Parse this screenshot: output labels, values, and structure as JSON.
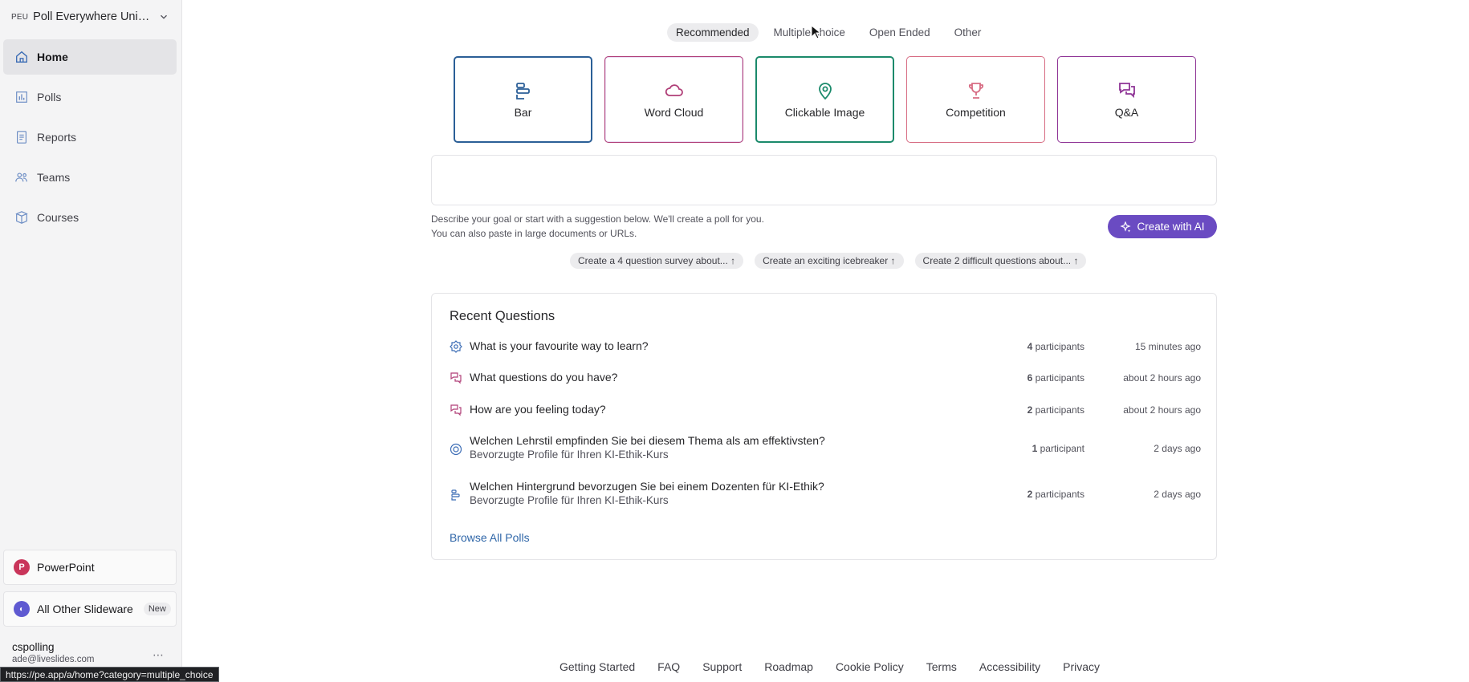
{
  "sidebar": {
    "org_abbr": "PEU",
    "org_name": "Poll Everywhere Unive...",
    "items": [
      {
        "label": "Home",
        "icon": "home-icon"
      },
      {
        "label": "Polls",
        "icon": "bar-chart-icon"
      },
      {
        "label": "Reports",
        "icon": "report-icon"
      },
      {
        "label": "Teams",
        "icon": "teams-icon"
      },
      {
        "label": "Courses",
        "icon": "courses-icon"
      }
    ],
    "powerpoint_label": "PowerPoint",
    "powerpoint_icon_letter": "P",
    "slideware_label": "All Other Slideware",
    "slideware_badge": "New",
    "user_name": "cspolling",
    "user_email": "ade@liveslides.com",
    "more": "⋯",
    "status_url": "https://pe.app/a/home?category=multiple_choice"
  },
  "tabs": [
    "Recommended",
    "Multiple choice",
    "Open Ended",
    "Other"
  ],
  "active_tab": "Recommended",
  "cards": [
    {
      "label": "Bar",
      "icon": "bar-poll-icon",
      "color": "#2b5f97"
    },
    {
      "label": "Word Cloud",
      "icon": "cloud-icon",
      "color": "#b03f78"
    },
    {
      "label": "Clickable Image",
      "icon": "map-pin-icon",
      "color": "#1b8a6b"
    },
    {
      "label": "Competition",
      "icon": "trophy-icon",
      "color": "#d76c83"
    },
    {
      "label": "Q&A",
      "icon": "chat-bubbles-icon",
      "color": "#8f3596"
    }
  ],
  "prompt": {
    "placeholder": "",
    "hint_line1": "Describe your goal or start with a suggestion below. We'll create a poll for you.",
    "hint_line2": "You can also paste in large documents or URLs.",
    "ai_button": "Create with AI",
    "suggestions": [
      "Create a 4 question survey about... ↑",
      "Create an exciting icebreaker ↑",
      "Create 2 difficult questions about... ↑"
    ]
  },
  "recent": {
    "title": "Recent Questions",
    "rows": [
      {
        "title": "What is your favourite way to learn?",
        "subtitle": "",
        "count": "4",
        "participants": "participants",
        "time": "15 minutes ago",
        "icon": "multiple-choice-icon"
      },
      {
        "title": "What questions do you have?",
        "subtitle": "",
        "count": "6",
        "participants": "participants",
        "time": "about 2 hours ago",
        "icon": "qa-icon"
      },
      {
        "title": "How are you feeling today?",
        "subtitle": "",
        "count": "2",
        "participants": "participants",
        "time": "about 2 hours ago",
        "icon": "qa-icon"
      },
      {
        "title": "Welchen Lehrstil empfinden Sie bei diesem Thema als am effektivsten?",
        "subtitle": "Bevorzugte Profile für Ihren KI-Ethik-Kurs",
        "count": "1",
        "participants": "participant",
        "time": "2 days ago",
        "icon": "target-icon"
      },
      {
        "title": "Welchen Hintergrund bevorzugen Sie bei einem Dozenten für KI-Ethik?",
        "subtitle": "Bevorzugte Profile für Ihren KI-Ethik-Kurs",
        "count": "2",
        "participants": "participants",
        "time": "2 days ago",
        "icon": "bar-poll-icon"
      }
    ],
    "browse_all": "Browse All Polls"
  },
  "footer": [
    "Getting Started",
    "FAQ",
    "Support",
    "Roadmap",
    "Cookie Policy",
    "Terms",
    "Accessibility",
    "Privacy"
  ]
}
